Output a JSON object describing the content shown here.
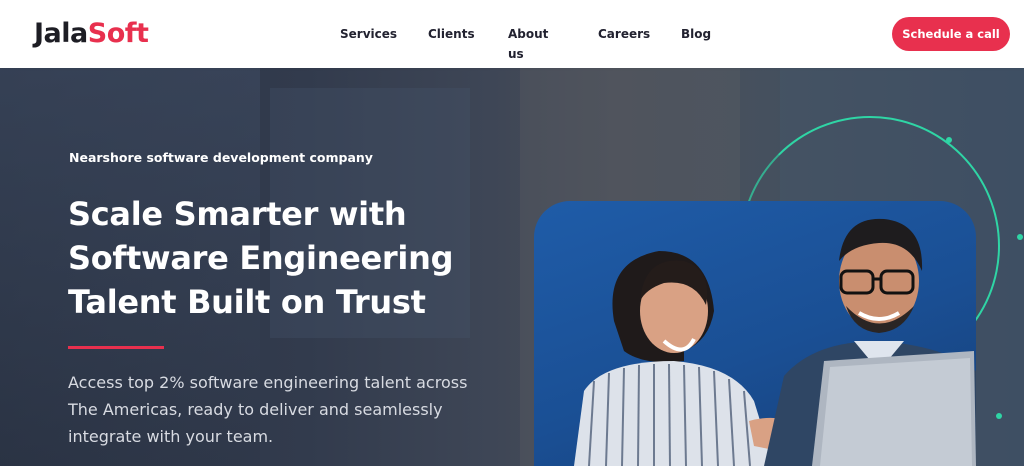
{
  "brand": {
    "logo_part1": "Jala",
    "logo_part2": "Soft"
  },
  "nav": {
    "items": [
      {
        "label": "Services"
      },
      {
        "label": "Clients"
      },
      {
        "label": "About us"
      },
      {
        "label": "Careers"
      },
      {
        "label": "Blog"
      }
    ],
    "cta_label": "Schedule a call"
  },
  "hero": {
    "eyebrow": "Nearshore software development company",
    "headline_line1": "Scale Smarter with",
    "headline_line2": "Software Engineering",
    "headline_line3": "Talent Built on Trust",
    "sub_line1": "Access top 2% software engineering talent across",
    "sub_line2": "The Americas, ready to deliver and seamlessly",
    "sub_line3": "integrate with your team."
  },
  "colors": {
    "accent": "#e8304e",
    "teal": "#2fd5a5",
    "card_blue": "#1f5ca8"
  }
}
